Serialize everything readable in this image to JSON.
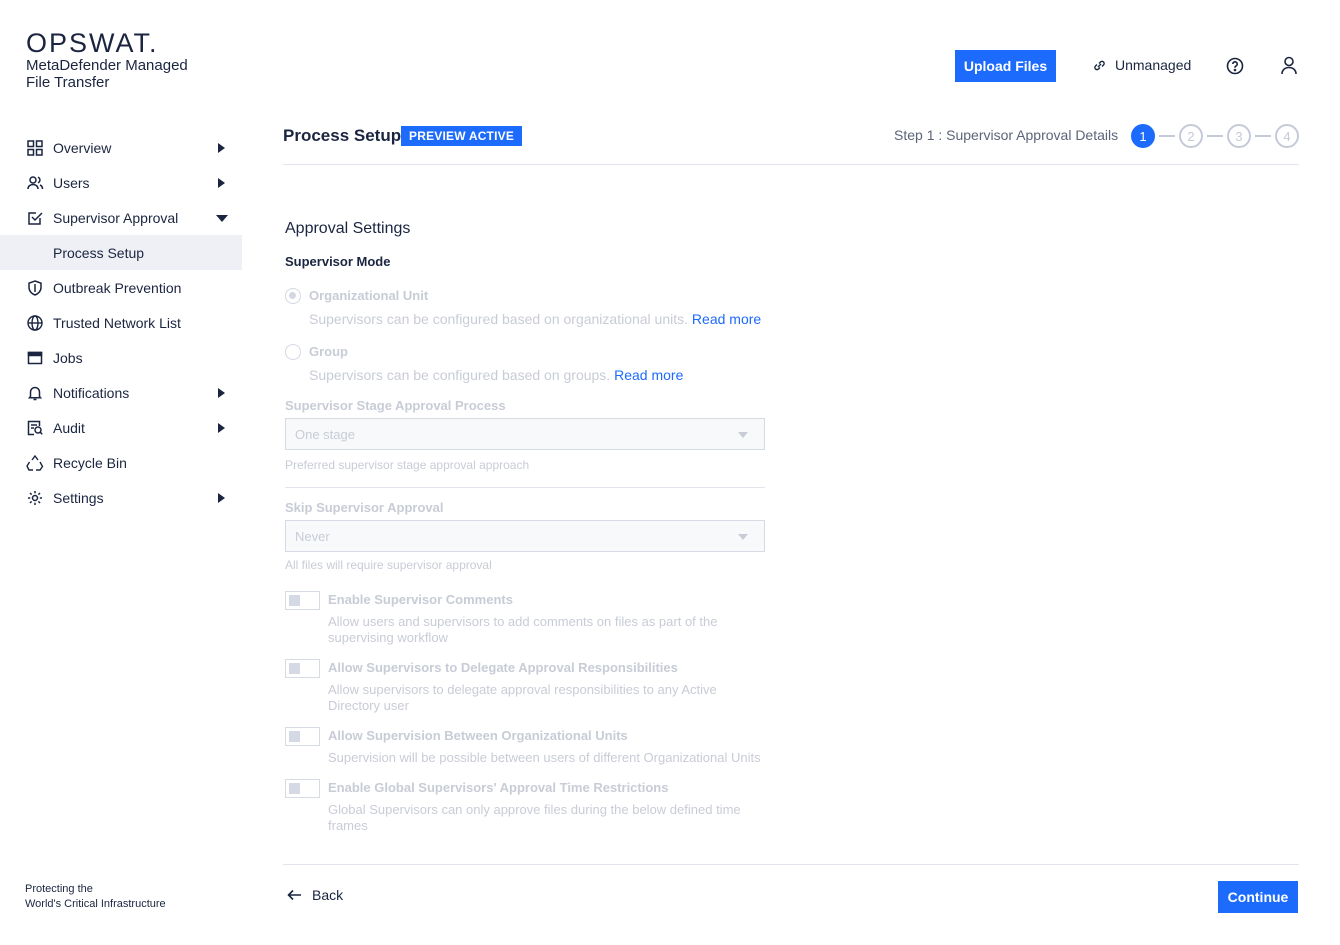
{
  "brand": {
    "logo": "OPSWAT.",
    "product_line1": "MetaDefender Managed",
    "product_line2": "File Transfer",
    "tagline_line1": "Protecting the",
    "tagline_line2": "World's Critical Infrastructure"
  },
  "sidebar": {
    "items": [
      {
        "label": "Overview",
        "icon": "grid-icon",
        "has_arrow": true
      },
      {
        "label": "Users",
        "icon": "users-icon",
        "has_arrow": true
      },
      {
        "label": "Supervisor Approval",
        "icon": "checkbox-icon",
        "expanded": true
      },
      {
        "label": "Process Setup",
        "sub": true,
        "selected": true
      },
      {
        "label": "Outbreak Prevention",
        "icon": "shield-icon"
      },
      {
        "label": "Trusted Network List",
        "icon": "globe-icon"
      },
      {
        "label": "Jobs",
        "icon": "window-icon"
      },
      {
        "label": "Notifications",
        "icon": "bell-icon",
        "has_arrow": true
      },
      {
        "label": "Audit",
        "icon": "audit-icon",
        "has_arrow": true
      },
      {
        "label": "Recycle Bin",
        "icon": "recycle-icon"
      },
      {
        "label": "Settings",
        "icon": "gear-icon",
        "has_arrow": true
      }
    ]
  },
  "header": {
    "upload_label": "Upload Files",
    "unmanaged_label": "Unmanaged"
  },
  "page": {
    "title": "Process Setup",
    "badge": "PREVIEW ACTIVE",
    "step_label": "Step 1 : Supervisor Approval Details",
    "steps": [
      "1",
      "2",
      "3",
      "4"
    ],
    "active_step": 1
  },
  "form": {
    "section_title": "Approval Settings",
    "mode_label": "Supervisor Mode",
    "radio_org_title": "Organizational Unit",
    "radio_org_desc": "Supervisors can be configured based on organizational units.",
    "radio_group_title": "Group",
    "radio_group_desc": "Supervisors can be configured based on groups.",
    "read_more": "Read more",
    "stage_label": "Supervisor Stage Approval Process",
    "stage_value": "One stage",
    "stage_helper": "Preferred supervisor stage approval approach",
    "skip_label": "Skip Supervisor Approval",
    "skip_value": "Never",
    "skip_helper": "All files will require supervisor approval",
    "toggles": [
      {
        "title": "Enable Supervisor Comments",
        "desc": "Allow users and supervisors to add comments on files as part of the supervising workflow"
      },
      {
        "title": "Allow Supervisors to Delegate Approval Responsibilities",
        "desc": "Allow supervisors to delegate approval responsibilities to any Active Directory user"
      },
      {
        "title": "Allow Supervision Between Organizational Units",
        "desc": "Supervision will be possible between users of different Organizational Units"
      },
      {
        "title": "Enable Global Supervisors' Approval Time Restrictions",
        "desc": "Global Supervisors can only approve files during the below defined time frames"
      }
    ]
  },
  "actions": {
    "back": "Back",
    "continue": "Continue"
  },
  "colors": {
    "accent": "#1d6bfc",
    "text": "#1b2540",
    "disabled": "#c8ccd6"
  }
}
